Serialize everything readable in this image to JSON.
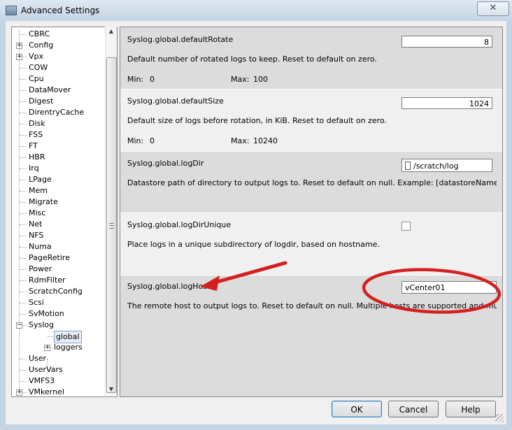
{
  "window": {
    "title": "Advanced Settings",
    "close_symbol": "✕"
  },
  "tree": {
    "items": [
      {
        "label": "CBRC",
        "expandable": false
      },
      {
        "label": "Config",
        "expandable": true
      },
      {
        "label": "Vpx",
        "expandable": true
      },
      {
        "label": "COW",
        "expandable": false
      },
      {
        "label": "Cpu",
        "expandable": false
      },
      {
        "label": "DataMover",
        "expandable": false
      },
      {
        "label": "Digest",
        "expandable": false
      },
      {
        "label": "DirentryCache",
        "expandable": false
      },
      {
        "label": "Disk",
        "expandable": false
      },
      {
        "label": "FSS",
        "expandable": false
      },
      {
        "label": "FT",
        "expandable": false
      },
      {
        "label": "HBR",
        "expandable": false
      },
      {
        "label": "Irq",
        "expandable": false
      },
      {
        "label": "LPage",
        "expandable": false
      },
      {
        "label": "Mem",
        "expandable": false
      },
      {
        "label": "Migrate",
        "expandable": false
      },
      {
        "label": "Misc",
        "expandable": false
      },
      {
        "label": "Net",
        "expandable": false
      },
      {
        "label": "NFS",
        "expandable": false
      },
      {
        "label": "Numa",
        "expandable": false
      },
      {
        "label": "PageRetire",
        "expandable": false
      },
      {
        "label": "Power",
        "expandable": false
      },
      {
        "label": "RdmFilter",
        "expandable": false
      },
      {
        "label": "ScratchConfig",
        "expandable": false
      },
      {
        "label": "Scsi",
        "expandable": false
      },
      {
        "label": "SvMotion",
        "expandable": false
      },
      {
        "label": "Syslog",
        "expandable": true,
        "expanded": true
      },
      {
        "label": "global",
        "child": true,
        "selected": true
      },
      {
        "label": "loggers",
        "child": true,
        "expandable": true
      },
      {
        "label": "User",
        "expandable": false
      },
      {
        "label": "UserVars",
        "expandable": false
      },
      {
        "label": "VMFS3",
        "expandable": false
      },
      {
        "label": "VMkernel",
        "expandable": true
      }
    ]
  },
  "settings": {
    "min_label": "Min:",
    "max_label": "Max:",
    "items": [
      {
        "name": "Syslog.global.defaultRotate",
        "value": "8",
        "description": "Default number of rotated logs to keep. Reset to default on zero.",
        "min": "0",
        "max": "100"
      },
      {
        "name": "Syslog.global.defaultSize",
        "value": "1024",
        "description": "Default size of logs before rotation, in KiB. Reset to default on zero.",
        "min": "0",
        "max": "10240"
      },
      {
        "name": "Syslog.global.logDir",
        "value": "/scratch/log",
        "description": "Datastore path of directory to output logs to. Reset to default on null. Example: [datastoreName]/logdir"
      },
      {
        "name": "Syslog.global.logDirUnique",
        "checked": false,
        "description": "Place logs in a unique subdirectory of logdir, based on hostname."
      },
      {
        "name": "Syslog.global.logHost",
        "value": "vCenter01",
        "description": "The remote host to output logs to. Reset to default on null. Multiple hosts are supported and must be s..."
      }
    ]
  },
  "buttons": {
    "ok": "OK",
    "cancel": "Cancel",
    "help": "Help"
  },
  "annotation": {
    "color": "#d42020"
  },
  "colors": {
    "shaded_row": "#dcdcdc",
    "selection_border": "#7da2ce"
  }
}
